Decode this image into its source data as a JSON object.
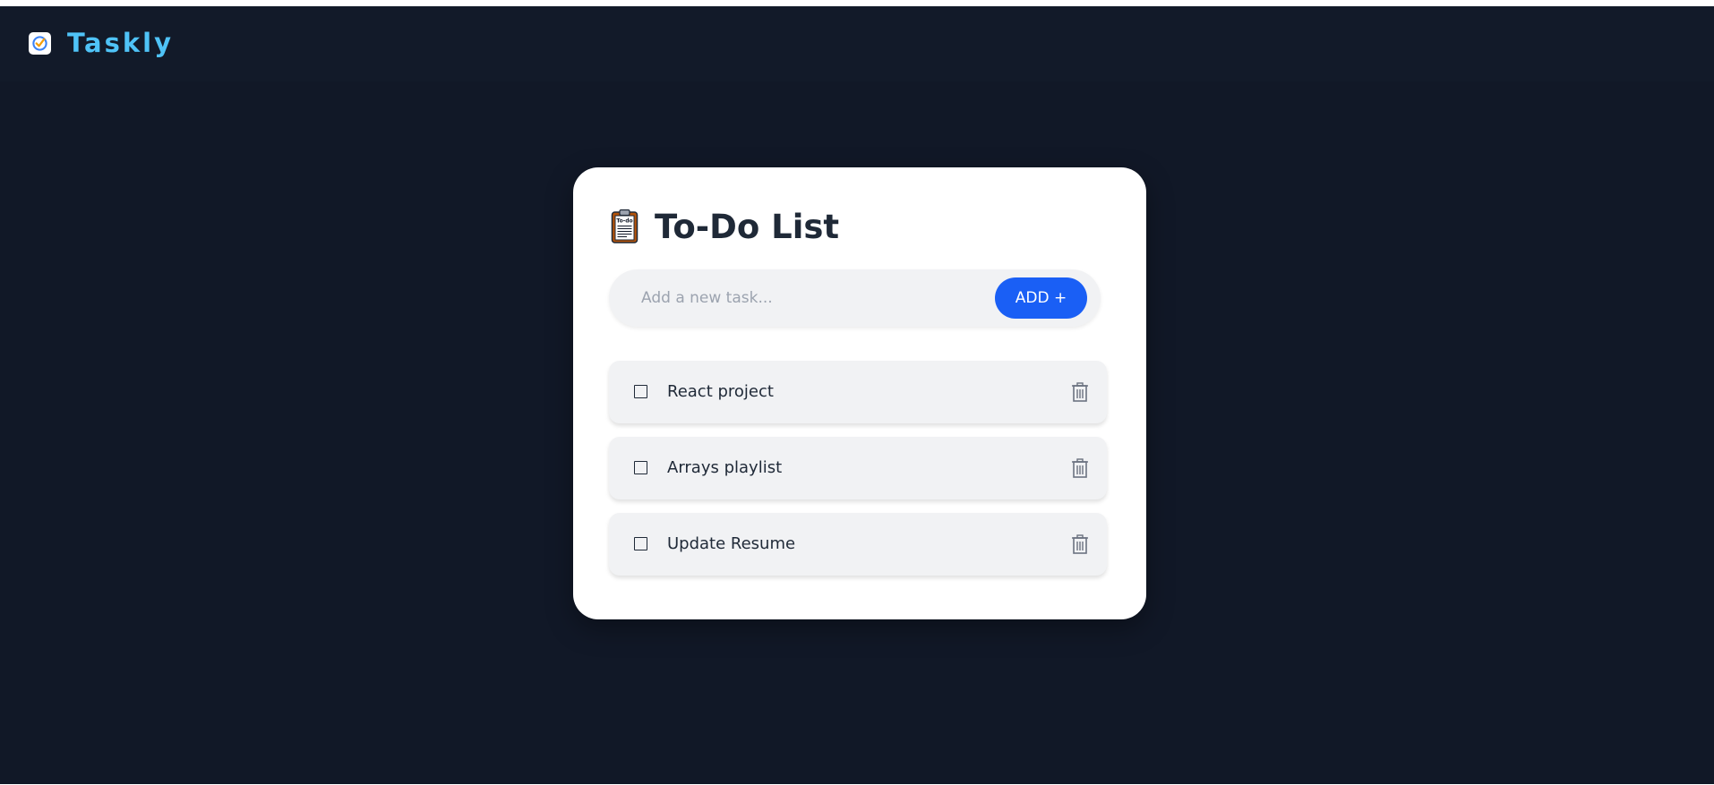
{
  "brand": {
    "name": "Taskly",
    "logo_icon": "checkmark-logo-icon",
    "color": "#4fc3f7"
  },
  "card": {
    "title": "To-Do List",
    "title_icon": "clipboard-todo-icon"
  },
  "add_task": {
    "placeholder": "Add a new task...",
    "value": "",
    "button_label": "ADD +",
    "button_color": "#1a5ff5"
  },
  "tasks": [
    {
      "text": "React project",
      "done": false
    },
    {
      "text": "Arrays playlist",
      "done": false
    },
    {
      "text": "Update Resume",
      "done": false
    }
  ],
  "colors": {
    "background": "#111827",
    "card": "#ffffff",
    "item": "#f1f2f4",
    "text": "#1f2937"
  }
}
